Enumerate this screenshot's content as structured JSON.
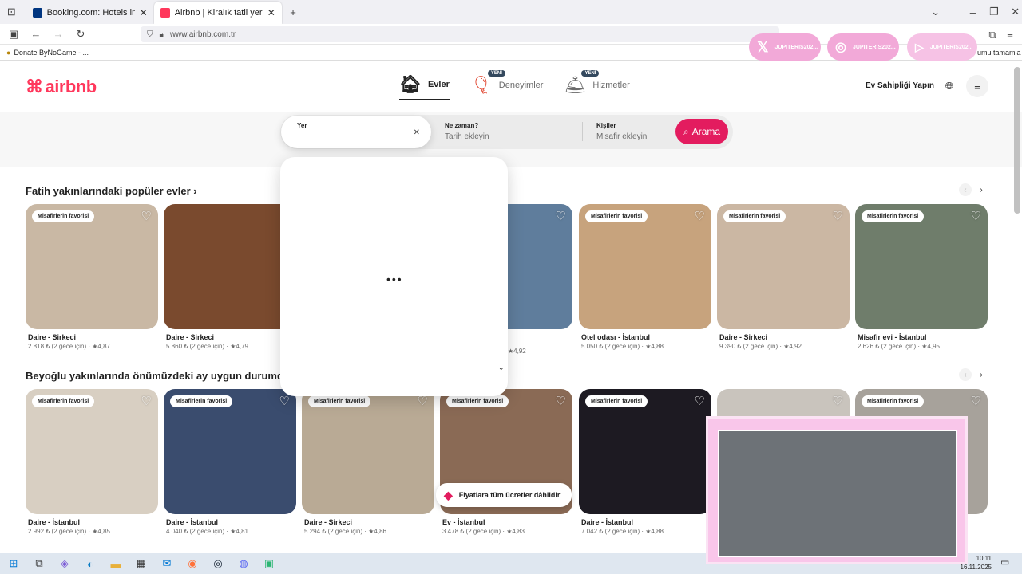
{
  "browser": {
    "tabs": [
      {
        "title": "Booking.com: Hotels in Lizbon.",
        "active": false,
        "color": "#003580"
      },
      {
        "title": "Airbnb | Kiralık tatil yerleri, kulüb",
        "active": true,
        "color": "#ff385c"
      }
    ],
    "url": "www.airbnb.com.tr",
    "bookmark": "Donate ByNoGame - ...",
    "bookmark_right": "umu tamamla"
  },
  "social": [
    {
      "handle": "JUPITERIS202..."
    },
    {
      "handle": "JUPITERIS202..."
    },
    {
      "handle": "JUPITERIS202..."
    }
  ],
  "header": {
    "logo": "airbnb",
    "categories": [
      {
        "label": "Evler",
        "active": true,
        "new": false
      },
      {
        "label": "Deneyimler",
        "active": false,
        "new": true
      },
      {
        "label": "Hizmetler",
        "active": false,
        "new": true
      }
    ],
    "new_badge": "YENİ",
    "host": "Ev Sahipliği Yapın"
  },
  "search": {
    "where_label": "Yer",
    "where_value": "",
    "when_label": "Ne zaman?",
    "when_placeholder": "Tarih ekleyin",
    "who_label": "Kişiler",
    "who_placeholder": "Misafir ekleyin",
    "button": "Arama"
  },
  "sections": [
    {
      "title": "Fatih yakınlarındaki popüler evler ›",
      "cards": [
        {
          "badge": "Misafirlerin favorisi",
          "title": "Daire - Sirkeci",
          "price": "2.818 ₺ (2 gece için) · ★4,87",
          "color": "#c9b8a4"
        },
        {
          "badge": "",
          "title": "Daire - Sirkeci",
          "price": "5.860 ₺ (2 gece için) · ★4,79",
          "color": "#7a4a2e"
        },
        {
          "badge": "Misafirlerin favorisi",
          "title": "Otel odası - İstanbul",
          "price": "5.050 ₺ (2 gece için) · ★4,88",
          "color": "#c7a37d"
        },
        {
          "badge": "Misafirlerin favorisi",
          "title": "Daire - Sirkeci",
          "price": "9.390 ₺ (2 gece için) · ★4,92",
          "color": "#cbb7a3"
        },
        {
          "badge": "Misafirlerin favorisi",
          "title": "Misafir evi - İstanbul",
          "price": "2.626 ₺ (2 gece için) · ★4,95",
          "color": "#6f7d6b"
        }
      ],
      "partial_price": "★4,92"
    },
    {
      "title": "Beyoğlu yakınlarında önümüzdeki ay uygun durumda olan",
      "cards": [
        {
          "badge": "Misafirlerin favorisi",
          "title": "Daire - İstanbul",
          "price": "2.992 ₺ (2 gece için) · ★4,85",
          "color": "#d8cfc2"
        },
        {
          "badge": "Misafirlerin favorisi",
          "title": "Daire - İstanbul",
          "price": "4.040 ₺ (2 gece için) · ★4,81",
          "color": "#3a4c6e"
        },
        {
          "badge": "Misafirlerin favorisi",
          "title": "Daire - Sirkeci",
          "price": "5.294 ₺ (2 gece için) · ★4,86",
          "color": "#b9aa95"
        },
        {
          "badge": "Misafirlerin favorisi",
          "title": "Ev - İstanbul",
          "price": "3.478 ₺ (2 gece için) · ★4,83",
          "color": "#8a6a55"
        },
        {
          "badge": "Misafirlerin favorisi",
          "title": "Daire - İstanbul",
          "price": "7.042 ₺ (2 gece için) · ★4,88",
          "color": "#1d1a22"
        },
        {
          "badge": "",
          "title": "",
          "price": "",
          "color": "#c9c4bd"
        },
        {
          "badge": "Misafirlerin favorisi",
          "title": "",
          "price": "",
          "color": "#a7a29b"
        }
      ]
    }
  ],
  "toast": "Fiyatlara tüm ücretler dâhildir",
  "clock": {
    "time": "10:11",
    "date": "16.11.2025"
  }
}
